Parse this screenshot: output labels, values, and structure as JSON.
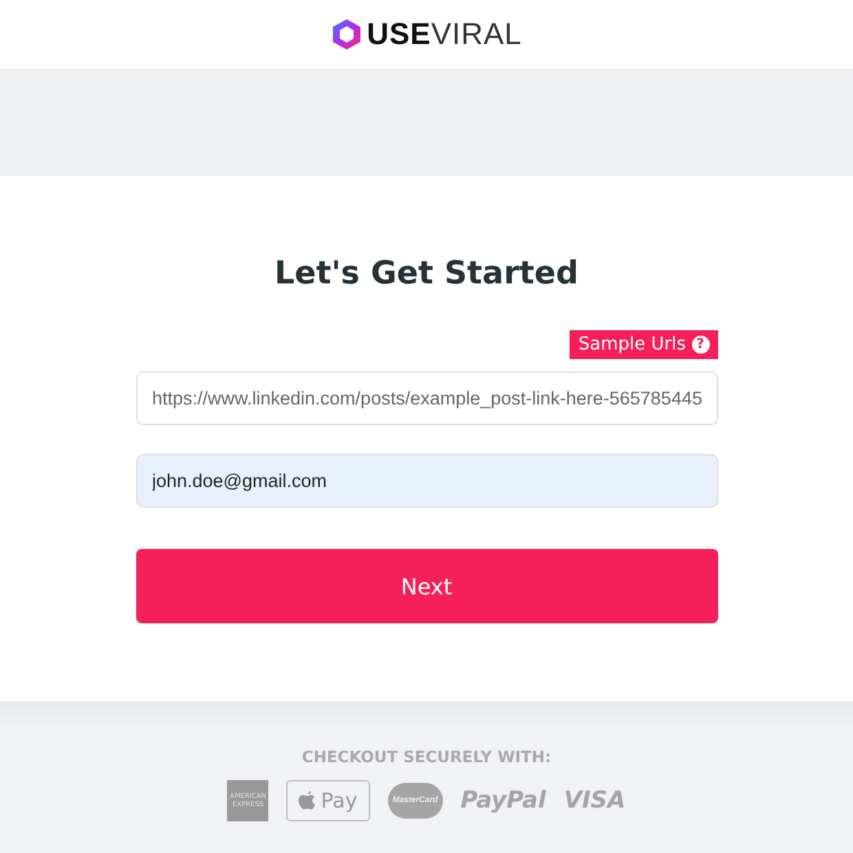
{
  "logo": {
    "bold": "USE",
    "light": "VIRAL"
  },
  "form": {
    "title": "Let's Get Started",
    "sample_button": "Sample Urls",
    "sample_icon": "?",
    "url_field": {
      "placeholder": "https://www.linkedin.com/posts/example_post-link-here-565785445"
    },
    "email_field": {
      "value": "john.doe@gmail.com",
      "autofilled": true
    },
    "submit": "Next"
  },
  "footer": {
    "heading": "CHECKOUT SECURELY WITH:",
    "payment_methods": [
      {
        "kind": "amex",
        "label": "AMERICAN EXPRESS"
      },
      {
        "kind": "applepay",
        "label": "Pay"
      },
      {
        "kind": "mastercard",
        "label": "MasterCard"
      },
      {
        "kind": "paypal",
        "label": "PayPal"
      },
      {
        "kind": "visa",
        "label": "VISA"
      }
    ]
  }
}
